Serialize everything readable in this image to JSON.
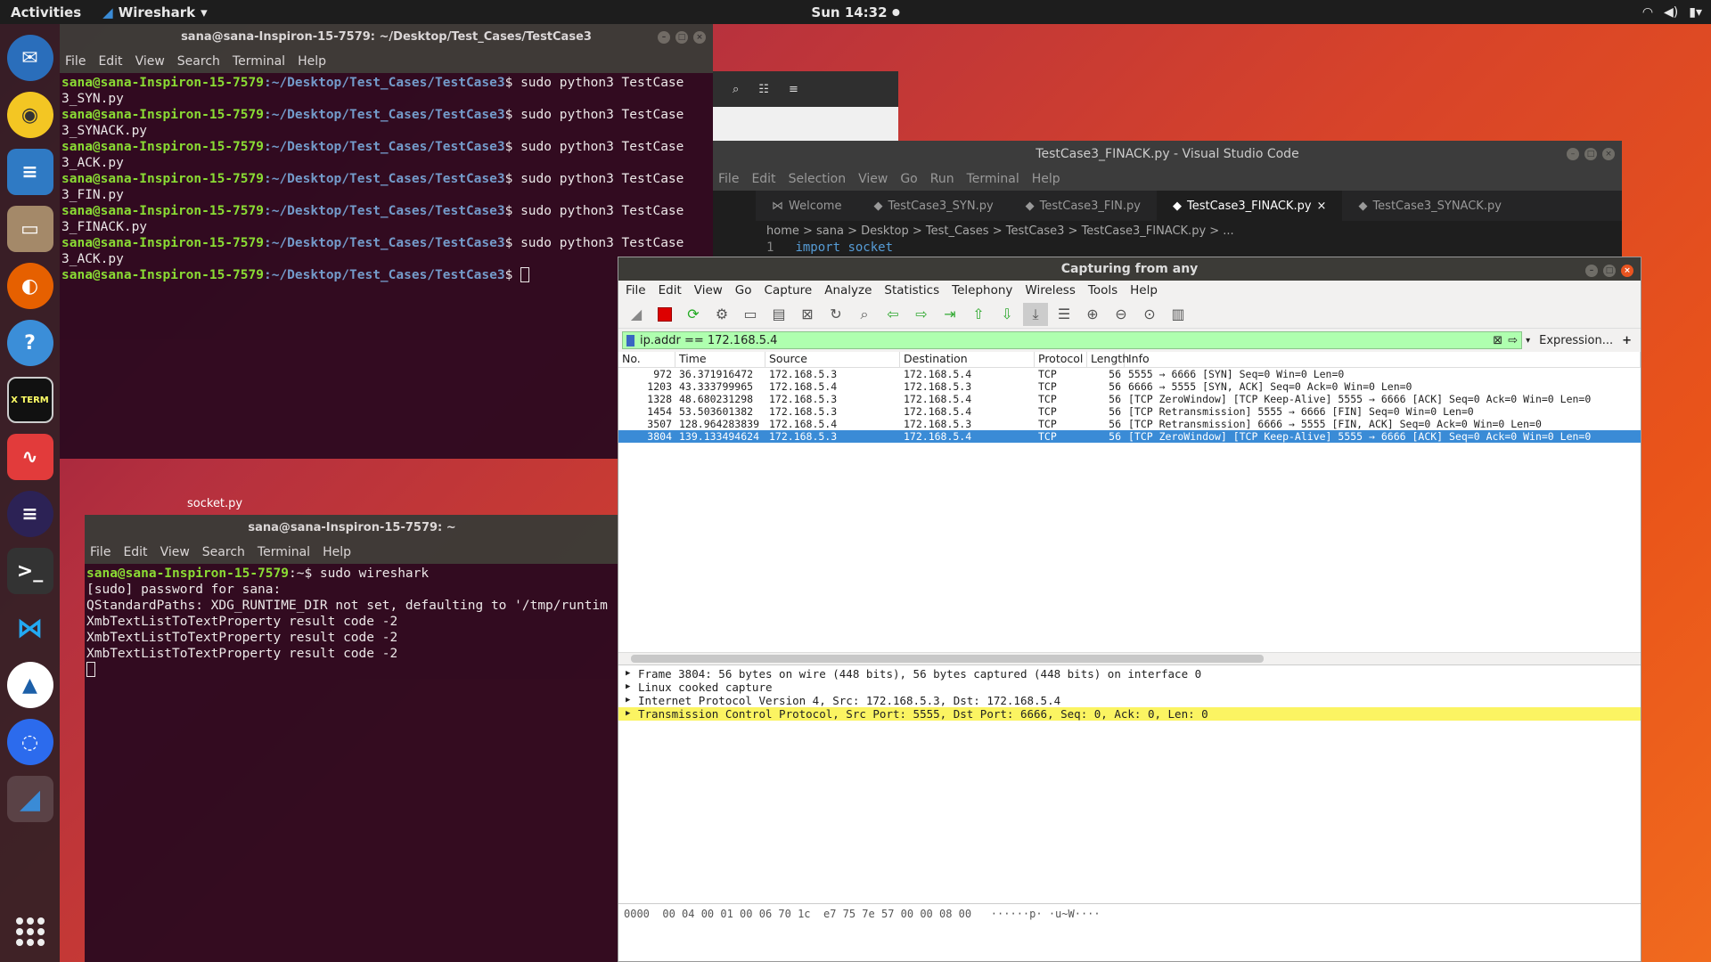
{
  "topbar": {
    "activities": "Activities",
    "app": "Wireshark",
    "clock": "Sun 14:32"
  },
  "dock": {
    "items": [
      "thunderbird-icon",
      "rhythmbox-icon",
      "libreoffice-writer-icon",
      "files-icon",
      "firefox-icon",
      "help-icon",
      "xterm-icon",
      "evince-icon",
      "eclipse-icon",
      "terminal-icon",
      "vscode-icon",
      "libreoffice-impress-icon",
      "signal-icon",
      "wireshark-icon"
    ],
    "xterm_label": "X TERM"
  },
  "term1": {
    "title": "sana@sana-Inspiron-15-7579: ~/Desktop/Test_Cases/TestCase3",
    "menu": [
      "File",
      "Edit",
      "View",
      "Search",
      "Terminal",
      "Help"
    ],
    "prompt": "sana@sana-Inspiron-15-7579",
    "path": ":~/Desktop/Test_Cases/TestCase3",
    "cmds": [
      [
        "$ sudo python3 TestCase",
        "3_SYN.py"
      ],
      [
        "$ sudo python3 TestCase",
        "3_SYNACK.py"
      ],
      [
        "$ sudo python3 TestCase",
        "3_ACK.py"
      ],
      [
        "$ sudo python3 TestCase",
        "3_FIN.py"
      ],
      [
        "$ sudo python3 TestCase",
        "3_FINACK.py"
      ],
      [
        "$ sudo python3 TestCase",
        "3_ACK.py"
      ]
    ],
    "last": "$ "
  },
  "term2": {
    "title": "sana@sana-Inspiron-15-7579: ~",
    "menu": [
      "File",
      "Edit",
      "View",
      "Search",
      "Terminal",
      "Help"
    ],
    "prompt": "sana@sana-Inspiron-15-7579",
    "path": ":~$ ",
    "cmd": "sudo wireshark",
    "lines": [
      "[sudo] password for sana:",
      "QStandardPaths: XDG_RUNTIME_DIR not set, defaulting to '/tmp/runtim",
      "XmbTextListToTextProperty result code -2",
      "XmbTextListToTextProperty result code -2",
      "XmbTextListToTextProperty result code -2"
    ]
  },
  "vscode": {
    "title": "TestCase3_FINACK.py - Visual Studio Code",
    "menu": [
      "File",
      "Edit",
      "Selection",
      "View",
      "Go",
      "Run",
      "Terminal",
      "Help"
    ],
    "tabs": [
      "Welcome",
      "TestCase3_SYN.py",
      "TestCase3_FIN.py",
      "TestCase3_FINACK.py",
      "TestCase3_SYNACK.py"
    ],
    "breadcrumb": "home > sana > Desktop > Test_Cases > TestCase3 > TestCase3_FINACK.py > ...",
    "line_no": "1",
    "code": "import socket"
  },
  "ws": {
    "title": "Capturing from any",
    "menu": [
      "File",
      "Edit",
      "View",
      "Go",
      "Capture",
      "Analyze",
      "Statistics",
      "Telephony",
      "Wireless",
      "Tools",
      "Help"
    ],
    "filter": "ip.addr == 172.168.5.4",
    "expression": "Expression...",
    "plus": "+",
    "cols": [
      "No.",
      "Time",
      "Source",
      "Destination",
      "Protocol",
      "Length",
      "Info"
    ],
    "rows": [
      [
        "972",
        "36.371916472",
        "172.168.5.3",
        "172.168.5.4",
        "TCP",
        "56",
        "5555 → 6666 [SYN] Seq=0 Win=0 Len=0"
      ],
      [
        "1203",
        "43.333799965",
        "172.168.5.4",
        "172.168.5.3",
        "TCP",
        "56",
        "6666 → 5555 [SYN, ACK] Seq=0 Ack=0 Win=0 Len=0"
      ],
      [
        "1328",
        "48.680231298",
        "172.168.5.3",
        "172.168.5.4",
        "TCP",
        "56",
        "[TCP ZeroWindow] [TCP Keep-Alive] 5555 → 6666 [ACK] Seq=0 Ack=0 Win=0 Len=0"
      ],
      [
        "1454",
        "53.503601382",
        "172.168.5.3",
        "172.168.5.4",
        "TCP",
        "56",
        "[TCP Retransmission] 5555 → 6666 [FIN] Seq=0 Win=0 Len=0"
      ],
      [
        "3507",
        "128.964283839",
        "172.168.5.4",
        "172.168.5.3",
        "TCP",
        "56",
        "[TCP Retransmission] 6666 → 5555 [FIN, ACK] Seq=0 Ack=0 Win=0 Len=0"
      ],
      [
        "3804",
        "139.133494624",
        "172.168.5.3",
        "172.168.5.4",
        "TCP",
        "56",
        "[TCP ZeroWindow] [TCP Keep-Alive] 5555 → 6666 [ACK] Seq=0 Ack=0 Win=0 Len=0"
      ]
    ],
    "details": [
      "Frame 3804: 56 bytes on wire (448 bits), 56 bytes captured (448 bits) on interface 0",
      "Linux cooked capture",
      "Internet Protocol Version 4, Src: 172.168.5.3, Dst: 172.168.5.4",
      "Transmission Control Protocol, Src Port: 5555, Dst Port: 6666, Seq: 0, Ack: 0, Len: 0"
    ],
    "hex": "0000  00 04 00 01 00 06 70 1c  e7 75 7e 57 00 00 08 00   ······p· ·u~W····"
  },
  "desktop": {
    "label": "socket.py"
  }
}
